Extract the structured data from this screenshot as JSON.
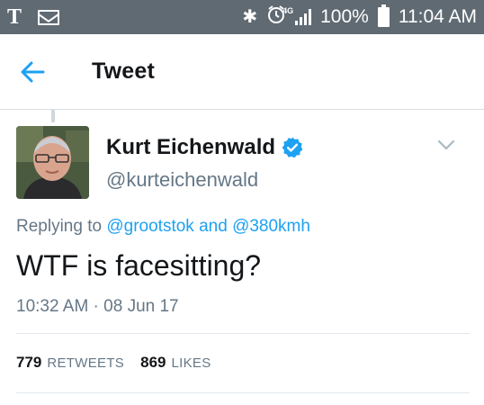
{
  "status_bar": {
    "battery": "100%",
    "time": "11:04 AM",
    "carrier_glyph": "T",
    "network": "4G",
    "icons": [
      "t-mobile-icon",
      "mail-icon",
      "bluetooth-icon",
      "alarm-icon",
      "signal-icon",
      "battery-icon"
    ]
  },
  "app_bar": {
    "title": "Tweet",
    "back_icon": "arrow-left-icon"
  },
  "tweet": {
    "display_name": "Kurt Eichenwald",
    "handle": "@kurteichenwald",
    "verified": true,
    "replying_prefix": "Replying to",
    "replying_users": [
      "@grootstok",
      "@380kmh"
    ],
    "replying_conjunction": "and",
    "text": "WTF is facesitting?",
    "timestamp": "10:32 AM · 08 Jun 17",
    "retweets": {
      "count": "779",
      "label": "RETWEETS"
    },
    "likes": {
      "count": "869",
      "label": "LIKES"
    }
  },
  "colors": {
    "status_bar": "#5f6a73",
    "accent": "#1da1f2",
    "text_primary": "#14171a",
    "text_secondary": "#657786"
  }
}
